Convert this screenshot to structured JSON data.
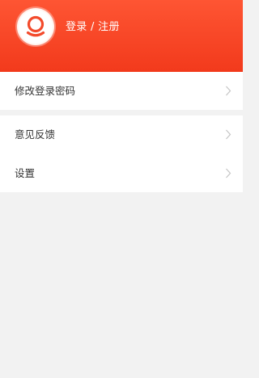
{
  "header": {
    "login_label": "登录 / 注册",
    "avatar_icon": "user-avatar-icon",
    "bg_color_top": "#fe5533",
    "bg_color_bottom": "#f23a1c"
  },
  "menu": {
    "group1": [
      {
        "label": "修改登录密码",
        "icon": "chevron-right-icon"
      }
    ],
    "group2": [
      {
        "label": "意见反馈",
        "icon": "chevron-right-icon"
      },
      {
        "label": "设置",
        "icon": "chevron-right-icon"
      }
    ]
  }
}
